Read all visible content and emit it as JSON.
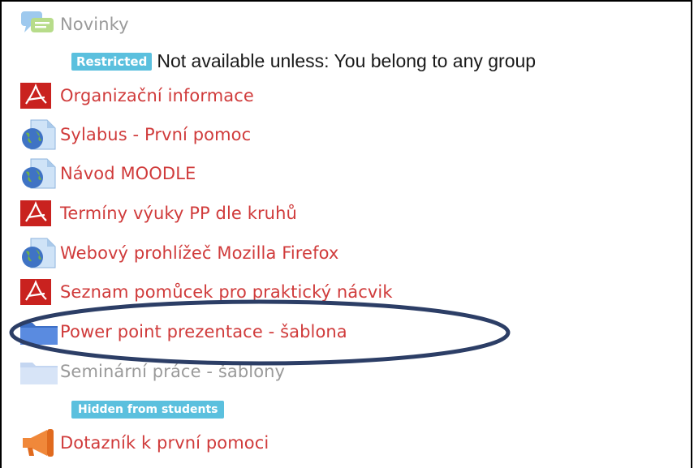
{
  "items": [
    {
      "label": "Novinky",
      "icon": "forum-icon",
      "state": "dimmed"
    },
    {
      "label": "Organizační informace",
      "icon": "pdf-icon"
    },
    {
      "label": "Sylabus - První pomoc",
      "icon": "web-link-icon"
    },
    {
      "label": "Návod MOODLE",
      "icon": "web-link-icon"
    },
    {
      "label": "Termíny výuky PP dle kruhů",
      "icon": "pdf-icon"
    },
    {
      "label": "Webový prohlížeč Mozilla Firefox",
      "icon": "web-link-icon"
    },
    {
      "label": "Seznam pomůcek pro praktický nácvik",
      "icon": "pdf-icon"
    },
    {
      "label": "Power point prezentace - šablona",
      "icon": "folder-icon",
      "highlighted": true
    },
    {
      "label": "Seminární práce - šablony",
      "icon": "folder-icon",
      "state": "dimmed"
    },
    {
      "label": "Dotazník k první pomoci",
      "icon": "feedback-megaphone-icon"
    }
  ],
  "restriction": {
    "badge": "Restricted",
    "text": "Not available unless: You belong to any group"
  },
  "hidden_badge": "Hidden from students",
  "colors": {
    "link": "#d03b3b",
    "dimmed": "#9a9a9a",
    "badge_bg": "#5bc0de",
    "pdf_red": "#c9221f",
    "folder_blue": "#4e7fd0",
    "annotation": "#2c3e66"
  }
}
